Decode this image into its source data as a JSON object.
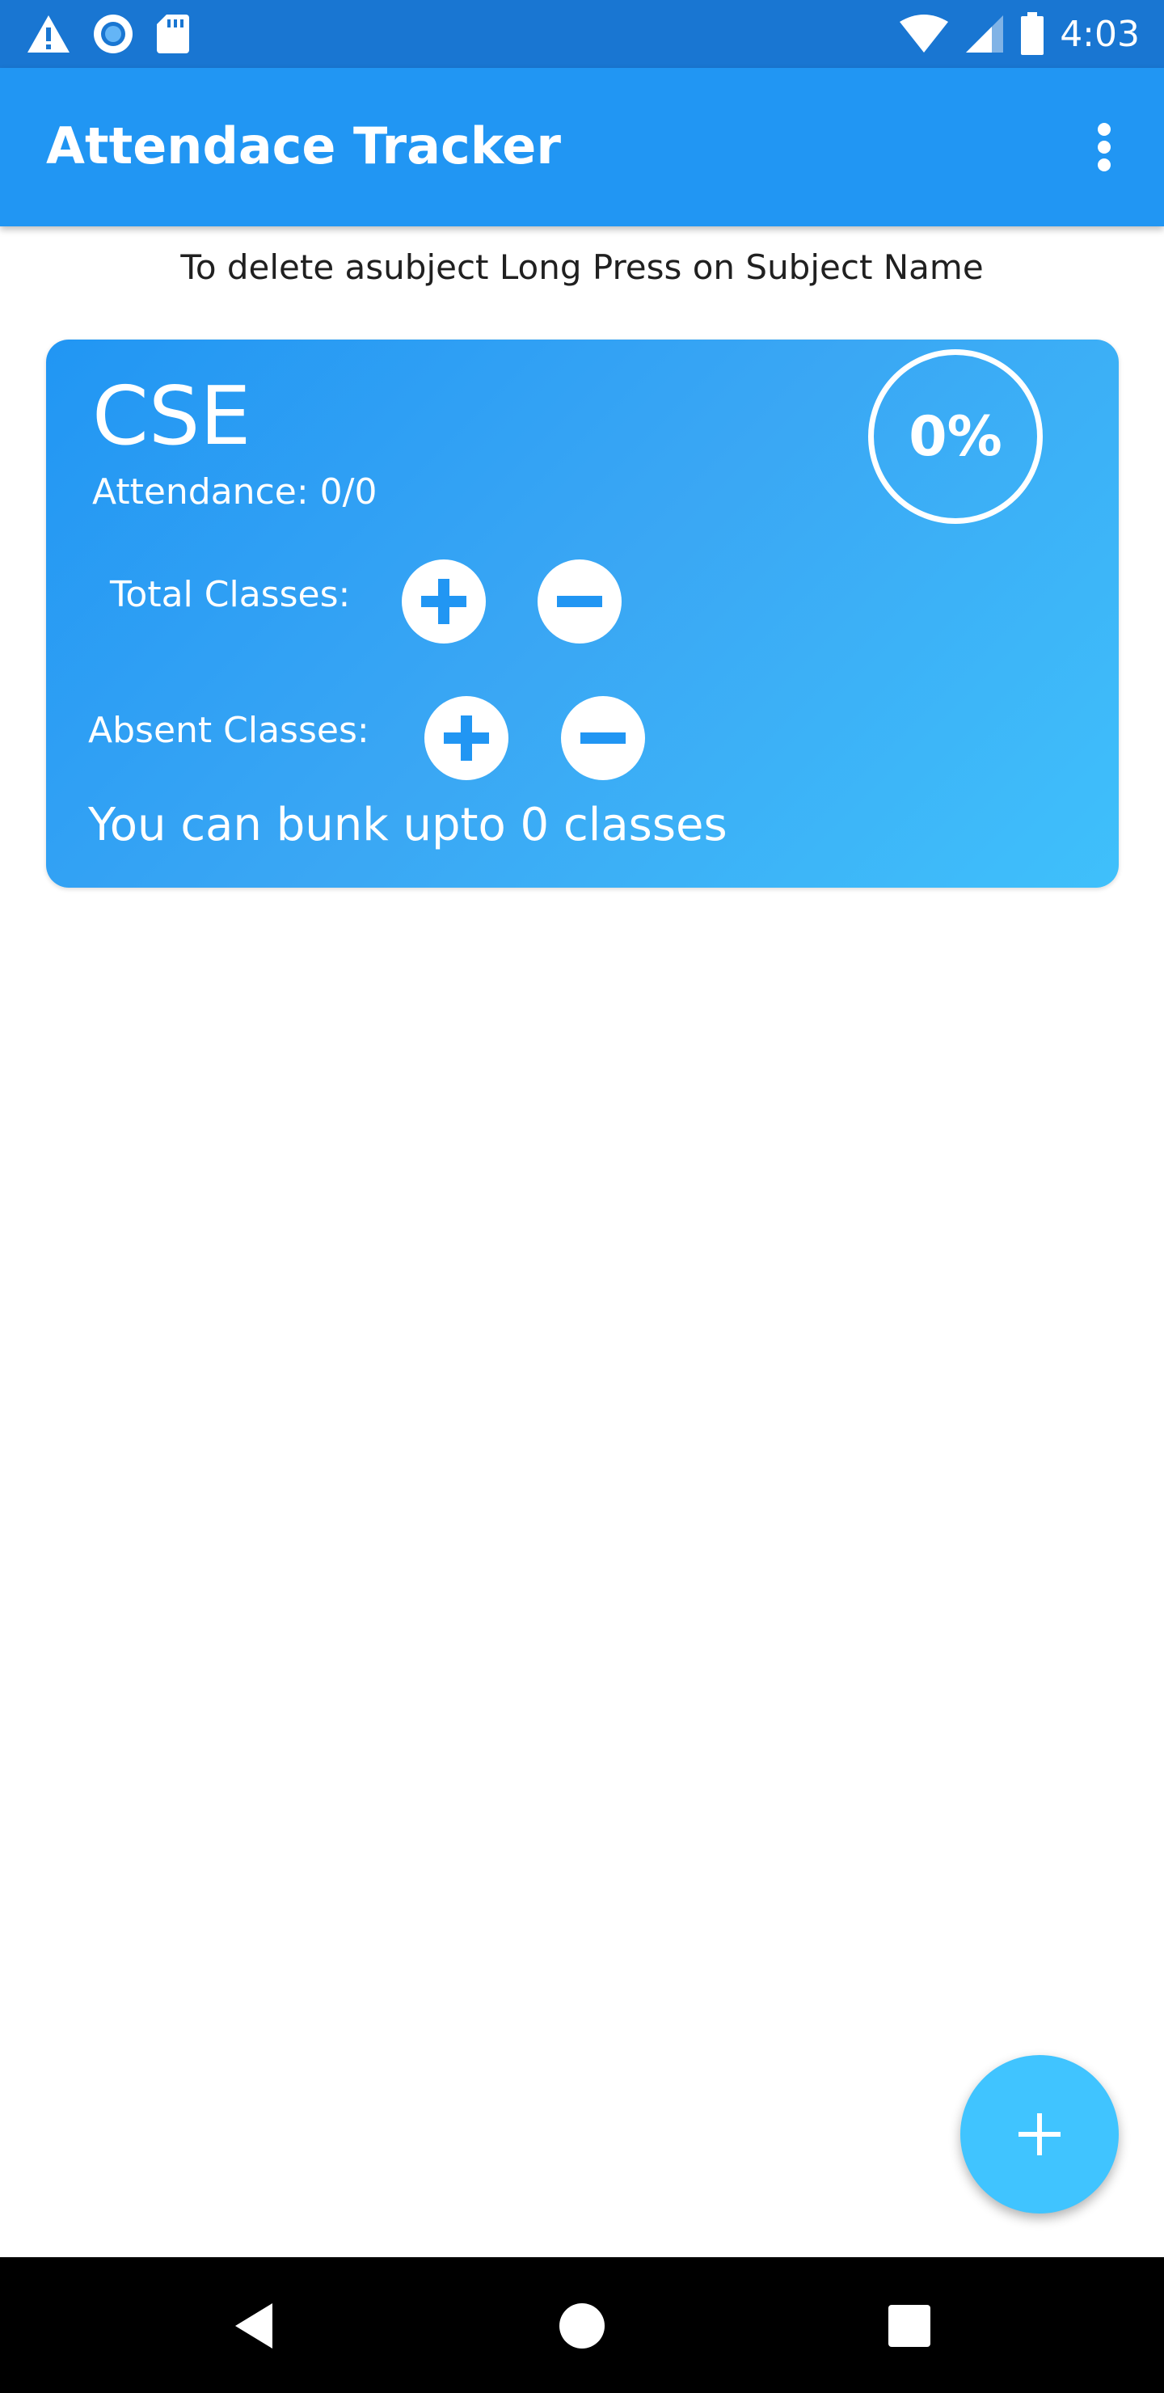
{
  "status_bar": {
    "time": "4:03",
    "left_icons": [
      "warning-icon",
      "record-icon",
      "sd-card-icon"
    ],
    "right_icons": [
      "wifi-icon",
      "cellular-signal-icon",
      "battery-icon"
    ]
  },
  "app_bar": {
    "title": "Attendace Tracker",
    "menu_icon": "more-vert-icon"
  },
  "hint": "To delete asubject Long Press on Subject Name",
  "subjects": [
    {
      "name": "CSE",
      "attendance": "Attendance: 0/0",
      "percent": "0%",
      "total_classes_label": "Total Classes:",
      "absent_classes_label": "Absent Classes:",
      "bunk_message": "You can bunk upto 0 classes"
    }
  ],
  "fab": {
    "icon": "add-icon"
  },
  "nav_bar": {
    "icons": [
      "back-icon",
      "home-icon",
      "recents-icon"
    ]
  },
  "colors": {
    "status_bar": "#1976D2",
    "app_bar": "#2196F3",
    "card_start": "#2196F3",
    "card_end": "#40C4FF",
    "fab": "#40C4FF",
    "nav_bar": "#000000"
  }
}
